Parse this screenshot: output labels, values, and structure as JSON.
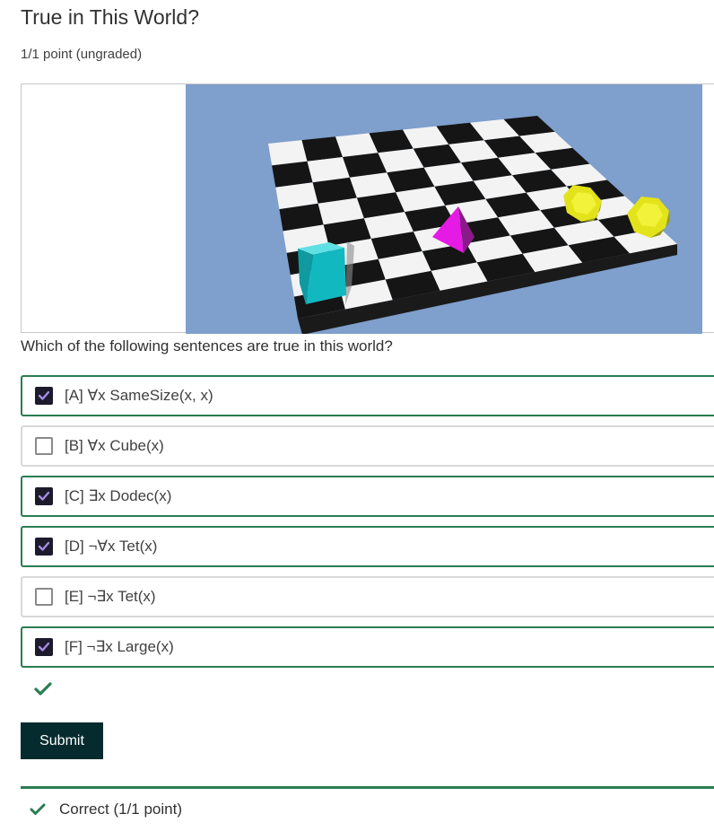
{
  "problem": {
    "title": "True in This World?",
    "points": "1/1 point (ungraded)",
    "question": "Which of the following sentences are true in this world?"
  },
  "colors": {
    "accent_green": "#2a7d53",
    "checkbox_fill": "#1c1a2b",
    "check_mark": "#a58ce4",
    "submit_bg": "#052b2e",
    "sky": "#7f9fcc",
    "cube": "#12b8bf",
    "tet": "#e51ae5",
    "dodec": "#e3e31b"
  },
  "choices": [
    {
      "label": "[A] ∀x SameSize(x, x)",
      "checked": true
    },
    {
      "label": "[B] ∀x Cube(x)",
      "checked": false
    },
    {
      "label": "[C] ∃x Dodec(x)",
      "checked": true
    },
    {
      "label": "[D] ¬∀x Tet(x)",
      "checked": true
    },
    {
      "label": "[E] ¬∃x Tet(x)",
      "checked": false
    },
    {
      "label": "[F] ¬∃x Large(x)",
      "checked": true
    }
  ],
  "status_icon": "checkmark-icon",
  "submit": {
    "label": "Submit"
  },
  "feedback": {
    "icon": "checkmark-icon",
    "text": "Correct (1/1 point)"
  }
}
